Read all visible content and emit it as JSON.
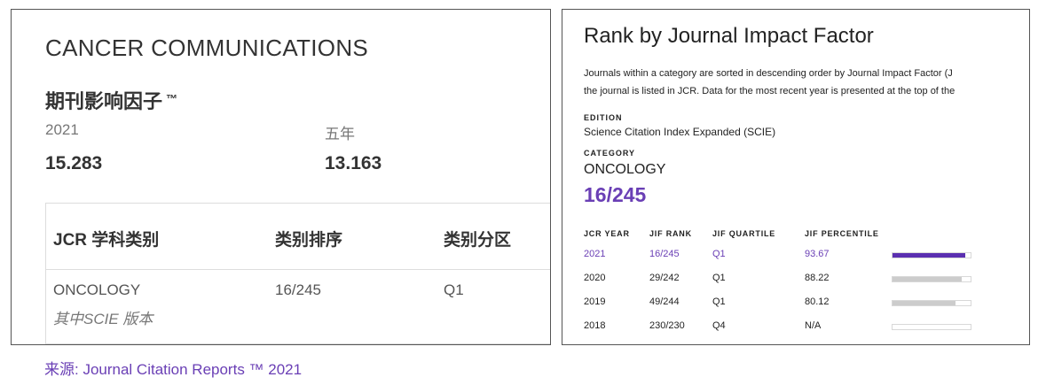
{
  "left": {
    "journal_name": "CANCER COMMUNICATIONS",
    "jif_heading": "期刊影响因子",
    "tm": "™",
    "col1_label": "2021",
    "col1_value": "15.283",
    "col2_label": "五年",
    "col2_value": "13.163",
    "category_table": {
      "headers": [
        "JCR 学科类别",
        "类别排序",
        "类别分区"
      ],
      "row": [
        "ONCOLOGY",
        "16/245",
        "Q1"
      ],
      "sub": "其中SCIE 版本"
    },
    "source": "来源: Journal Citation Reports ™ 2021"
  },
  "right": {
    "title": "Rank by Journal Impact Factor",
    "description_lines": [
      "Journals within a category are sorted in descending order by Journal Impact Factor (J",
      "the journal is listed in JCR. Data for the most recent year is presented at the top of the"
    ],
    "edition_label": "EDITION",
    "edition_value": "Science Citation Index Expanded (SCIE)",
    "category_label": "CATEGORY",
    "category_value": "ONCOLOGY",
    "category_rank": "16/245",
    "table_headers": [
      "JCR YEAR",
      "JIF RANK",
      "JIF QUARTILE",
      "JIF PERCENTILE"
    ],
    "rows": [
      {
        "year": "2021",
        "rank": "16/245",
        "quartile": "Q1",
        "percentile": "93.67",
        "fill": 0.9367
      },
      {
        "year": "2020",
        "rank": "29/242",
        "quartile": "Q1",
        "percentile": "88.22",
        "fill": 0.8822
      },
      {
        "year": "2019",
        "rank": "49/244",
        "quartile": "Q1",
        "percentile": "80.12",
        "fill": 0.8012
      },
      {
        "year": "2018",
        "rank": "230/230",
        "quartile": "Q4",
        "percentile": "N/A",
        "fill": 0
      }
    ]
  },
  "colors": {
    "accent": "#6a3fb5",
    "bar_active": "#5b2fb0",
    "bar_inactive": "#cccccc"
  }
}
